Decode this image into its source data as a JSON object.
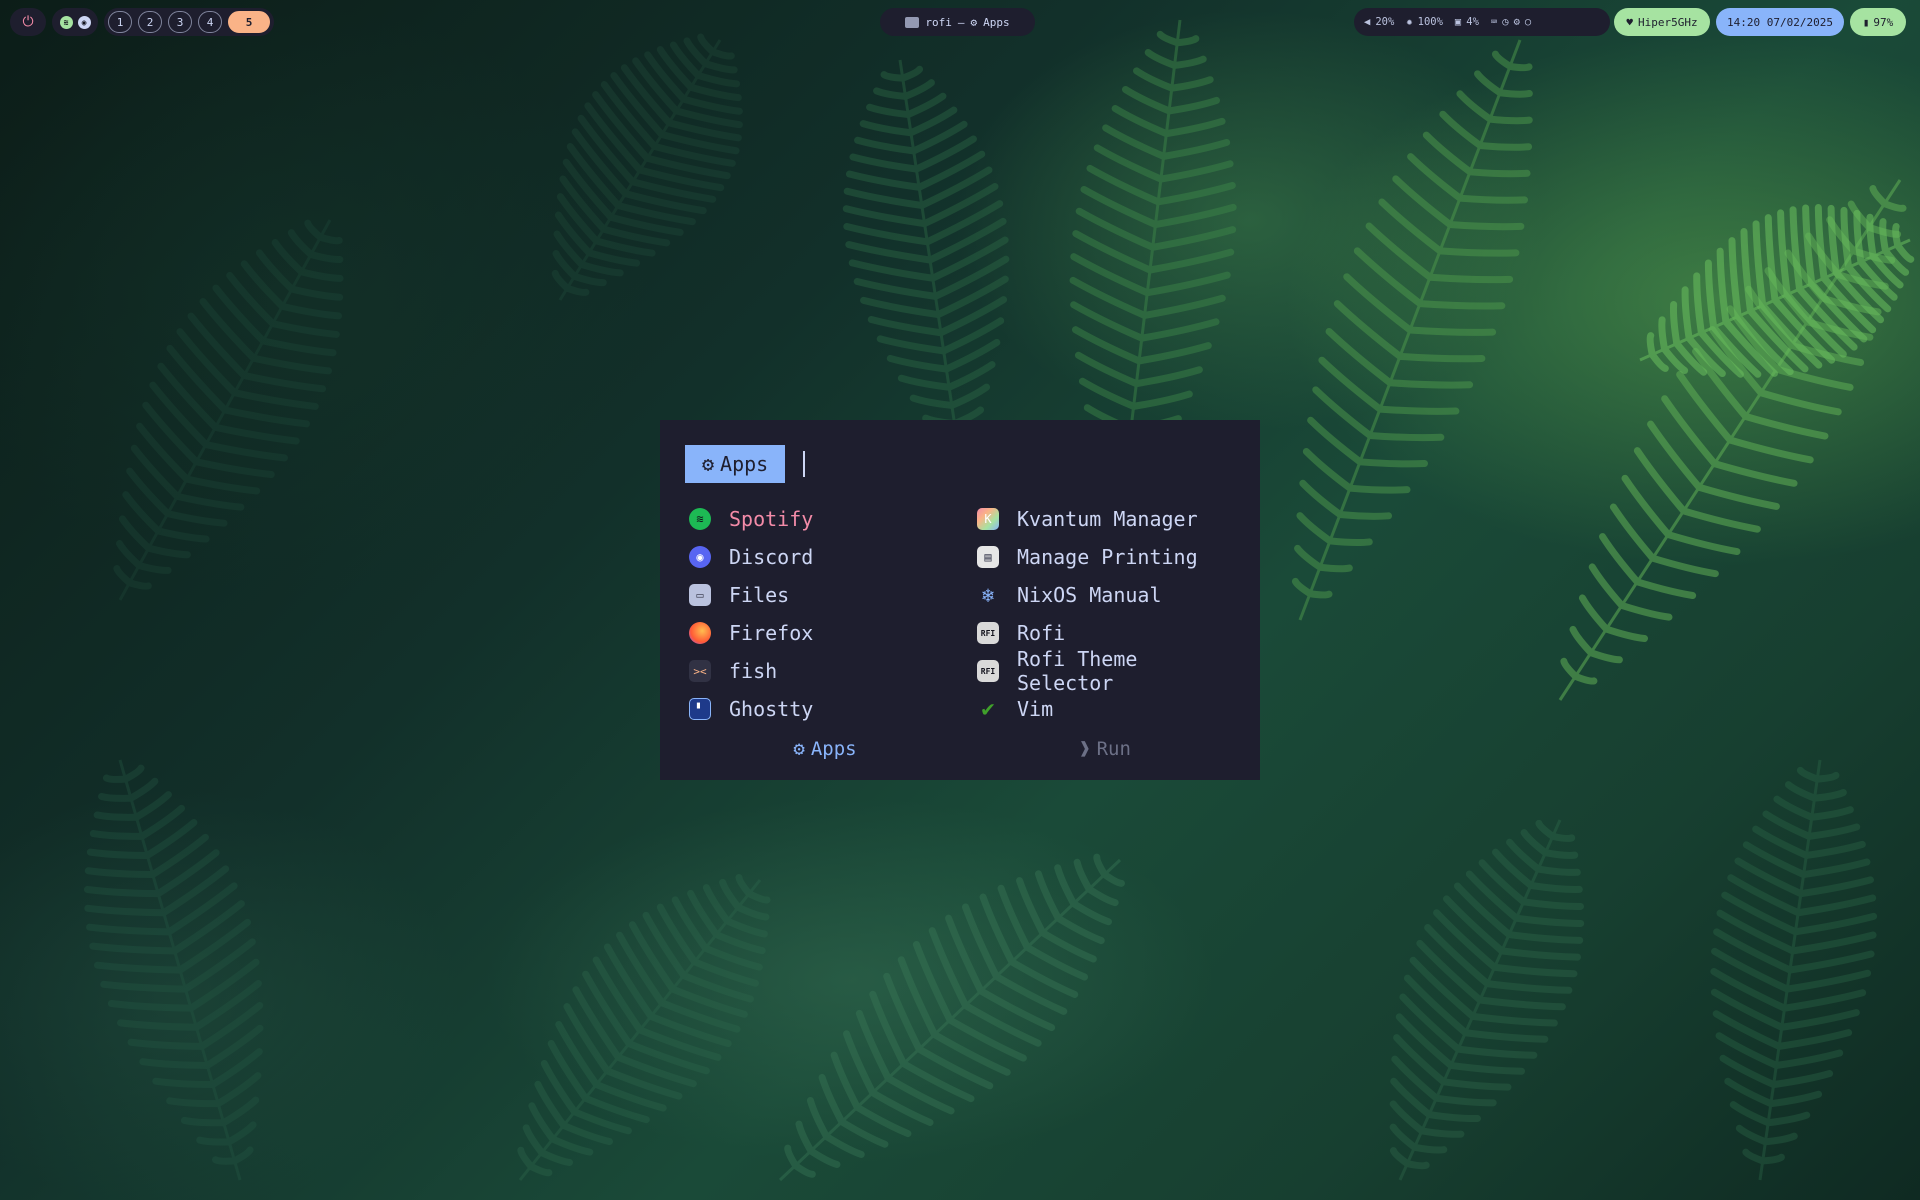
{
  "topbar": {
    "power_icon": "power-icon",
    "apps": [
      {
        "name": "spotify-icon",
        "color": "#a6e3a1"
      },
      {
        "name": "discord-icon",
        "color": "#ffffff"
      }
    ],
    "workspaces": [
      "1",
      "2",
      "3",
      "4",
      "5"
    ],
    "active_workspace": "5",
    "window_title": {
      "app": "rofi",
      "separator": "–",
      "mode": "Apps"
    },
    "volume": "20%",
    "brightness": "100%",
    "memory": "4%",
    "network": "Hiper5GHz",
    "clock": "14:20 07/02/2025",
    "battery": "97%",
    "colors": {
      "bar_bg": "#1e1e2e",
      "green": "#a6e3a1",
      "blue": "#89b4fa",
      "peach": "#fab387"
    }
  },
  "rofi": {
    "prompt": "Apps",
    "input_value": "",
    "entries_left": [
      {
        "label": "Spotify",
        "icon": "spotify-icon",
        "selected": true
      },
      {
        "label": "Discord",
        "icon": "discord-icon"
      },
      {
        "label": "Files",
        "icon": "files-icon"
      },
      {
        "label": "Firefox",
        "icon": "firefox-icon"
      },
      {
        "label": "fish",
        "icon": "fish-icon"
      },
      {
        "label": "Ghostty",
        "icon": "ghostty-icon"
      }
    ],
    "entries_right": [
      {
        "label": "Kvantum Manager",
        "icon": "kvantum-icon"
      },
      {
        "label": "Manage Printing",
        "icon": "printer-icon"
      },
      {
        "label": "NixOS Manual",
        "icon": "nixos-icon"
      },
      {
        "label": "Rofi",
        "icon": "rofi-icon"
      },
      {
        "label": "Rofi Theme Selector",
        "icon": "rofi-icon"
      },
      {
        "label": "Vim",
        "icon": "vim-icon"
      }
    ],
    "modes": [
      {
        "label": "Apps",
        "symbol": "⚙",
        "active": true
      },
      {
        "label": "Run",
        "symbol": "❱",
        "active": false
      }
    ],
    "colors": {
      "background": "#1e1e2e",
      "text": "#cdd6f4",
      "selected": "#f38ba8",
      "accent": "#89b4fa",
      "muted": "#6c7086"
    }
  }
}
